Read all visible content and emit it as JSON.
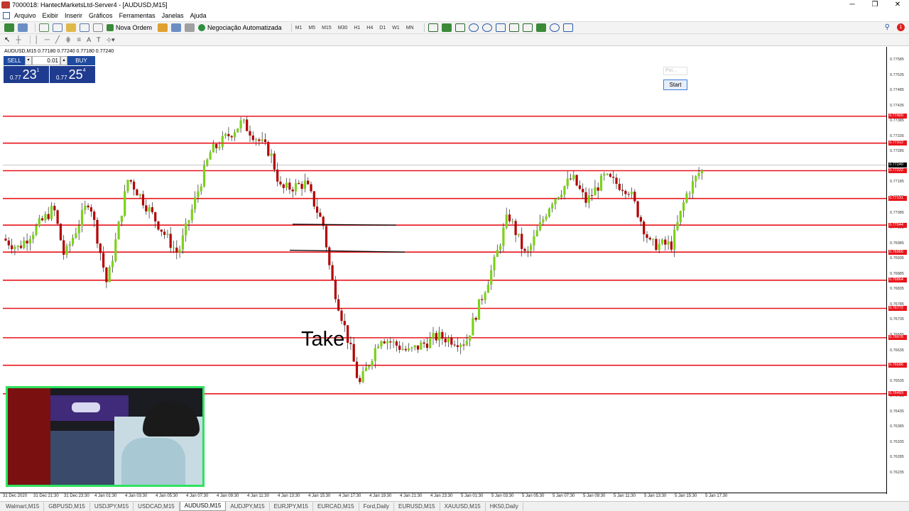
{
  "window": {
    "title": "7000018: HantecMarketsLtd-Server4 - [AUDUSD,M15]"
  },
  "menu": [
    "Arquivo",
    "Exibir",
    "Inserir",
    "Gráficos",
    "Ferramentas",
    "Janelas",
    "Ajuda"
  ],
  "toolbar": {
    "new_order": "Nova Ordem",
    "auto_trading": "Negociação Automatizada",
    "timeframes": [
      "M1",
      "M5",
      "M15",
      "M30",
      "H1",
      "H4",
      "D1",
      "W1",
      "MN"
    ]
  },
  "chart": {
    "symbol_info": "AUDUSD,M15  0.77180 0.77240 0.77180 0.77240",
    "sell_label": "SELL",
    "buy_label": "BUY",
    "lot": "0.01",
    "bid_prefix": "0.77",
    "bid_big": "23",
    "bid_sup": "1",
    "ask_prefix": "0.77",
    "ask_big": "25",
    "ask_sup": "4",
    "dialog_field": "Poi...",
    "start_label": "Start",
    "annotation": "Take",
    "price_labels": [
      "0.77585",
      "0.77535",
      "0.77485",
      "0.77435",
      "0.77385",
      "0.77335",
      "0.77285",
      "0.77185",
      "0.77135",
      "0.77085",
      "0.77035",
      "0.76985",
      "0.76935",
      "0.76885",
      "0.76835",
      "0.76785",
      "0.76735",
      "0.76685",
      "0.76635",
      "0.76585",
      "0.76535",
      "0.76485",
      "0.76435",
      "0.76385",
      "0.76335",
      "0.76285",
      "0.76235"
    ],
    "levels": [
      "0.77400",
      "0.77312",
      "0.77222",
      "0.77131",
      "0.77044",
      "0.76956",
      "0.76864",
      "0.76772",
      "0.76676",
      "0.76586",
      "0.76493"
    ],
    "current_price": "0.77240",
    "time_labels": [
      "31 Dec 2020",
      "31 Dec 21:30",
      "31 Dec 23:30",
      "4 Jan 01:30",
      "4 Jan 03:30",
      "4 Jan 05:30",
      "4 Jan 07:30",
      "4 Jan 09:30",
      "4 Jan 11:30",
      "4 Jan 13:30",
      "4 Jan 15:30",
      "4 Jan 17:30",
      "4 Jan 19:30",
      "4 Jan 21:30",
      "4 Jan 23:30",
      "5 Jan 01:30",
      "5 Jan 03:30",
      "5 Jan 05:30",
      "5 Jan 07:30",
      "5 Jan 09:30",
      "5 Jan 11:30",
      "5 Jan 13:30",
      "5 Jan 15:30",
      "5 Jan 17:30"
    ]
  },
  "tabs": [
    "Walmart,M15",
    "GBPUSD,M15",
    "USDJPY,M15",
    "USDCAD,M15",
    "AUDUSD,M15",
    "AUDJPY,M15",
    "EURJPY,M15",
    "EURCAD,M15",
    "Ford,Daily",
    "EURUSD,M15",
    "XAUUSD,M15",
    "HK50,Daily"
  ],
  "active_tab": "AUDUSD,M15",
  "colors": {
    "level_line": "#e8141c",
    "bull_candle": "#7cd11a",
    "bear_candle": "#b30000",
    "panel_blue": "#1f4aa0",
    "webcam_border": "#2ee25e"
  },
  "icons": [
    "app-icon",
    "new-chart-icon",
    "profiles-icon",
    "zoom-in-icon",
    "zoom-out-icon",
    "search-icon",
    "notification-icon",
    "cursor-icon",
    "crosshair-icon"
  ]
}
